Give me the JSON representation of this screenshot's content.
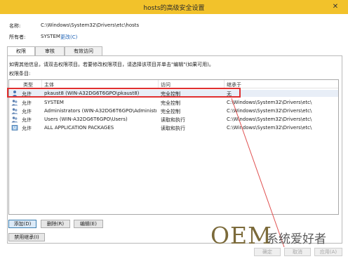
{
  "window": {
    "title": "hosts的高级安全设置",
    "close_glyph": "✕"
  },
  "fields": {
    "name_label": "名称:",
    "name_value": "C:\\Windows\\System32\\Drivers\\etc\\hosts",
    "owner_label": "所有者:",
    "owner_value": "SYSTEM",
    "owner_change": "更改(C)"
  },
  "tabs": [
    {
      "label": "权限"
    },
    {
      "label": "审核"
    },
    {
      "label": "有效访问"
    }
  ],
  "info_text": "如需其他信息，请双击权限项目。若要修改权限项目，请选择该项目并单击\"编辑\"(如果可用)。",
  "list_label": "权限条目:",
  "columns": {
    "type": "类型",
    "principal": "主体",
    "access": "访问",
    "inherited": "继承于"
  },
  "rows": [
    {
      "icon": "user-icon",
      "type": "允许",
      "principal": "pkaust8 (WIN-A32DG6T6GPO\\pkaust8)",
      "access": "完全控制",
      "inherited": "无"
    },
    {
      "icon": "group-icon",
      "type": "允许",
      "principal": "SYSTEM",
      "access": "完全控制",
      "inherited": "C:\\Windows\\System32\\Drivers\\etc\\"
    },
    {
      "icon": "group-icon",
      "type": "允许",
      "principal": "Administrators (WIN-A32DG6T6GPO\\Administr...",
      "access": "完全控制",
      "inherited": "C:\\Windows\\System32\\Drivers\\etc\\"
    },
    {
      "icon": "group-icon",
      "type": "允许",
      "principal": "Users (WIN-A32DG6T6GPO\\Users)",
      "access": "读取和执行",
      "inherited": "C:\\Windows\\System32\\Drivers\\etc\\"
    },
    {
      "icon": "package-icon",
      "type": "允许",
      "principal": "ALL APPLICATION PACKAGES",
      "access": "读取和执行",
      "inherited": "C:\\Windows\\System32\\Drivers\\etc\\"
    }
  ],
  "buttons": {
    "add": "添加(D)",
    "remove": "删除(R)",
    "edit": "编辑(E)",
    "disable_inheritance": "禁用继承(I)",
    "ok": "确定",
    "cancel": "取消",
    "apply": "应用(A)"
  },
  "watermark": {
    "brand": "OEM",
    "text": "系统爱好者"
  },
  "colors": {
    "titlebar": "#f2c22b",
    "highlight": "#e03030",
    "link": "#1a5fb4"
  }
}
